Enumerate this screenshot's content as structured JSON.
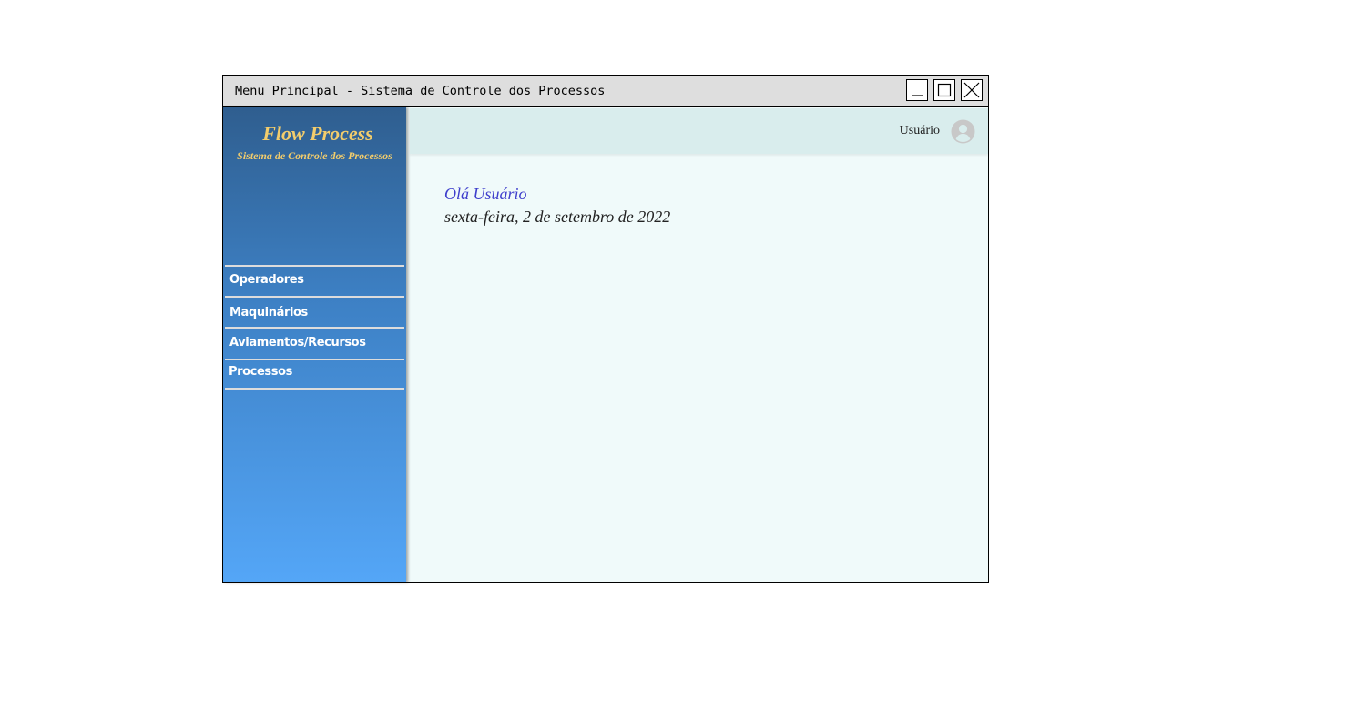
{
  "window": {
    "title": "Menu Principal - Sistema de Controle dos Processos",
    "controls": [
      "minimize-icon",
      "maximize-icon",
      "close-icon"
    ]
  },
  "sidebar": {
    "brand_title": "Flow Process",
    "brand_subtitle": "Sistema de Controle dos Processos",
    "items": [
      {
        "label": "Operadores"
      },
      {
        "label": "Maquinários"
      },
      {
        "label": "Aviamentos/Recursos"
      },
      {
        "label": "Processos"
      }
    ]
  },
  "header": {
    "user_label": "Usuário",
    "avatar_icon": "user-avatar-icon"
  },
  "main": {
    "greeting": "Olá Usuário",
    "date": "sexta-feira, 2 de setembro de 2022"
  },
  "colors": {
    "brand_text": "#f3cd6c",
    "sidebar_top": "#2f5e8f",
    "sidebar_bottom": "#54a6f7",
    "greeting": "#3f3fcc",
    "header_bg": "#d9eded",
    "content_bg": "#f0fafa"
  }
}
